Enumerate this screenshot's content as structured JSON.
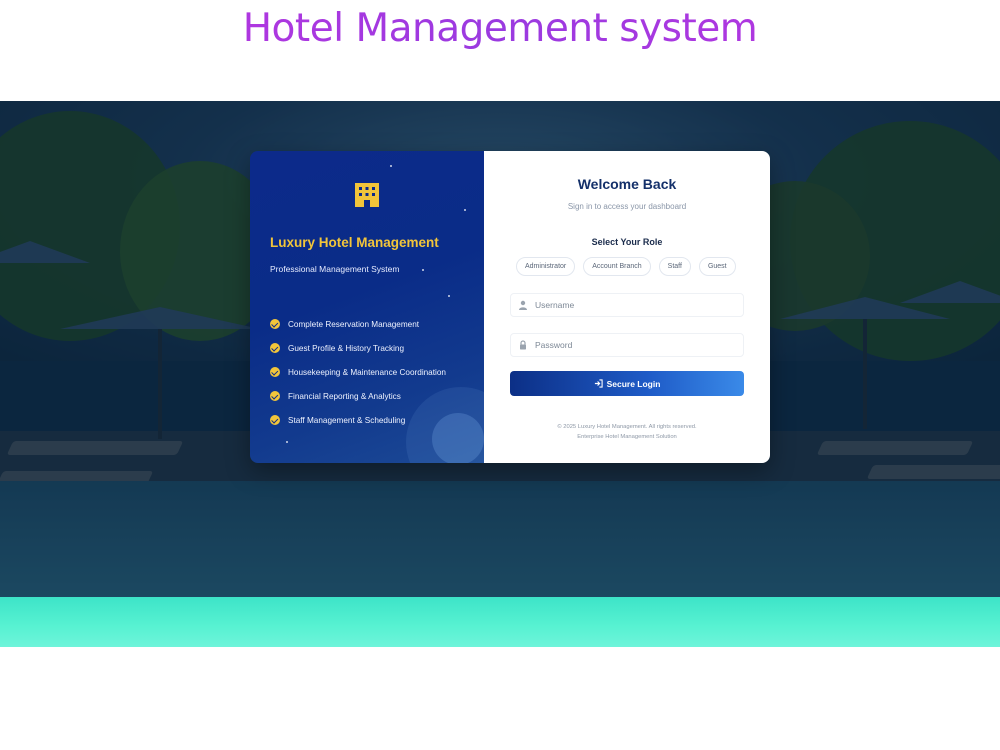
{
  "page": {
    "heading": "Hotel Management system"
  },
  "brand": {
    "title": "Luxury Hotel Management",
    "subtitle": "Professional Management System",
    "features": [
      "Complete Reservation Management",
      "Guest Profile & History Tracking",
      "Housekeeping & Maintenance Coordination",
      "Financial Reporting & Analytics",
      "Staff Management & Scheduling"
    ]
  },
  "login": {
    "title": "Welcome Back",
    "subtitle": "Sign in to access your dashboard",
    "role_label": "Select Your Role",
    "roles": [
      "Administrator",
      "Account Branch",
      "Staff",
      "Guest"
    ],
    "username": {
      "placeholder": "Username",
      "value": ""
    },
    "password": {
      "placeholder": "Password",
      "value": ""
    },
    "submit_label": "Secure Login",
    "footer_copyright": "© 2025 Luxury Hotel Management. All rights reserved.",
    "footer_tagline": "Enterprise Hotel Management Solution"
  },
  "colors": {
    "heading": "#b02ee0",
    "brand_accent": "#f2c53a",
    "panel": "#0c2a8a",
    "title": "#14306a",
    "button_start": "#0c2f86",
    "button_end": "#3a8ae8"
  },
  "icons": {
    "hotel": "hotel-building-icon",
    "check": "check-circle-icon",
    "user": "user-icon",
    "lock": "lock-icon",
    "login": "sign-in-icon"
  }
}
